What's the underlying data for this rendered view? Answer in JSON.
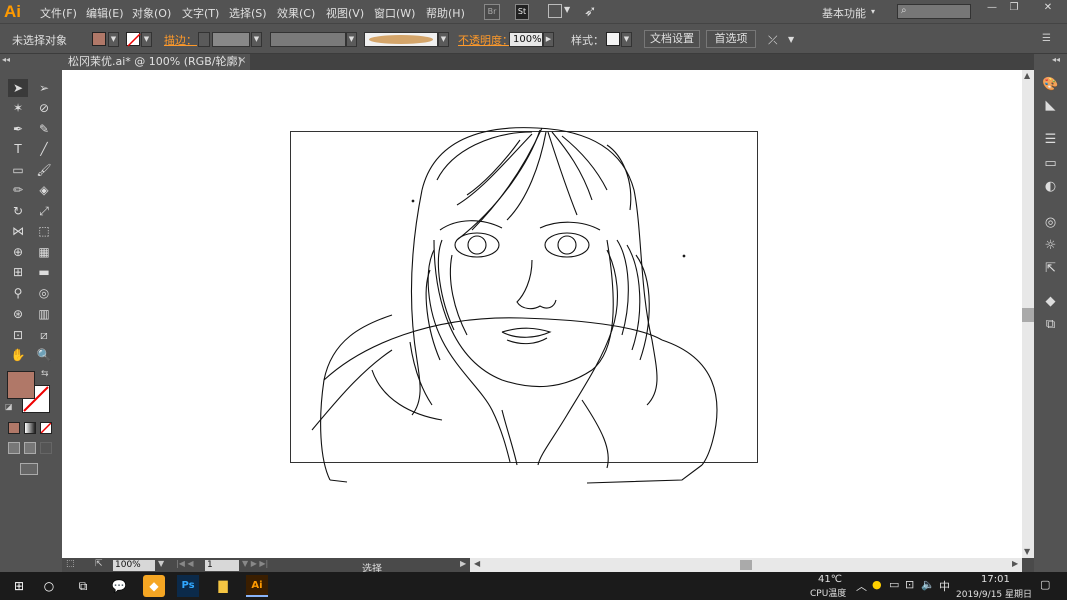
{
  "app": {
    "logo": "Ai"
  },
  "menu": [
    "文件(F)",
    "编辑(E)",
    "对象(O)",
    "文字(T)",
    "选择(S)",
    "效果(C)",
    "视图(V)",
    "窗口(W)",
    "帮助(H)"
  ],
  "menu_buttons": {
    "br": "Br",
    "st": "St"
  },
  "workspace": "基本功能",
  "control": {
    "selection": "未选择对象",
    "stroke_label": "描边：",
    "opacity_label": "不透明度：",
    "opacity_value": "100%",
    "style_label": "样式：",
    "doc_setup": "文档设置",
    "preferences": "首选项",
    "fill_color": "#b07868"
  },
  "doc_tab": {
    "title": "松冈茉优.ai* @ 100% (RGB/轮廓)",
    "close": "×"
  },
  "tools_fill_color": "#b07868",
  "status": {
    "zoom": "100%",
    "artboard": "1",
    "tool": "选择"
  },
  "tray": {
    "temp": "41℃",
    "temp_label": "CPU温度",
    "ime": "中",
    "time": "17:01",
    "date": "2019/9/15 星期日"
  }
}
